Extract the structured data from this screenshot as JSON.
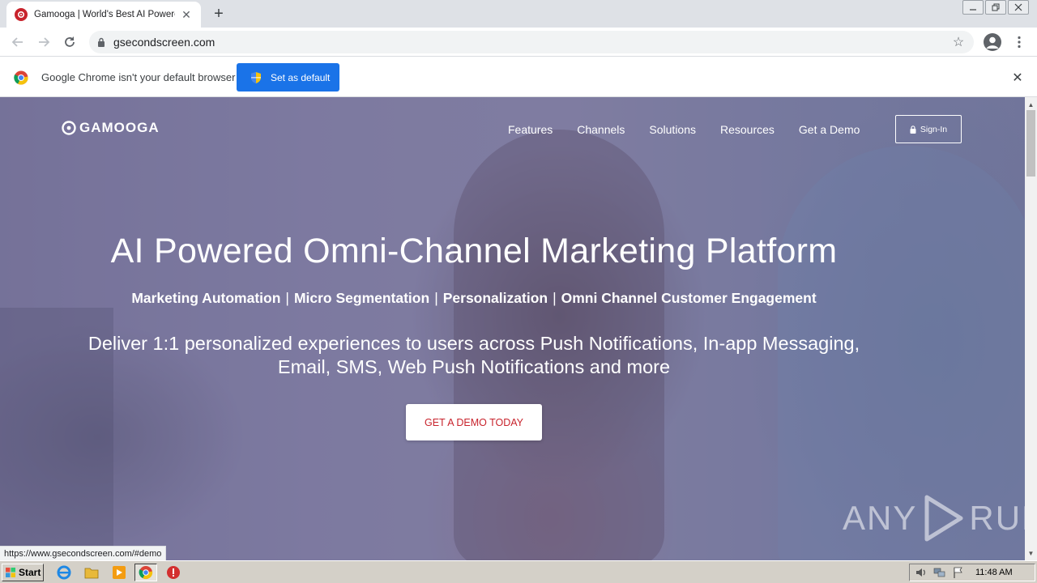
{
  "browser": {
    "tab": {
      "title": "Gamooga | World's Best AI Powered",
      "close_icon": "close-icon"
    },
    "new_tab_label": "+",
    "window_controls": [
      "minimize",
      "restore",
      "close"
    ],
    "url": "gsecondscreen.com",
    "infobar": {
      "message": "Google Chrome isn't your default browser",
      "button_label": "Set as default"
    },
    "status_url": "https://www.gsecondscreen.com/#demo"
  },
  "site": {
    "logo_text": "GAMOOGA",
    "nav": [
      "Features",
      "Channels",
      "Solutions",
      "Resources",
      "Get a Demo"
    ],
    "signin_label": "Sign-In",
    "hero": {
      "title": "AI Powered Omni-Channel Marketing Platform",
      "subtitle_items": [
        "Marketing Automation",
        "Micro Segmentation",
        "Personalization",
        "Omni Channel Customer Engagement"
      ],
      "subtitle_separator": "|",
      "description_line1": "Deliver 1:1 personalized experiences to users across Push Notifications, In-app Messaging,",
      "description_line2": "Email, SMS, Web Push Notifications and more",
      "cta_label": "GET A DEMO TODAY"
    },
    "watermark_text_left": "ANY",
    "watermark_text_right": "RUN"
  },
  "taskbar": {
    "start_label": "Start",
    "clock": "11:48 AM"
  },
  "colors": {
    "brand_red": "#c8232c",
    "chrome_blue": "#1a73e8",
    "hero_tint": "#6c6896"
  }
}
